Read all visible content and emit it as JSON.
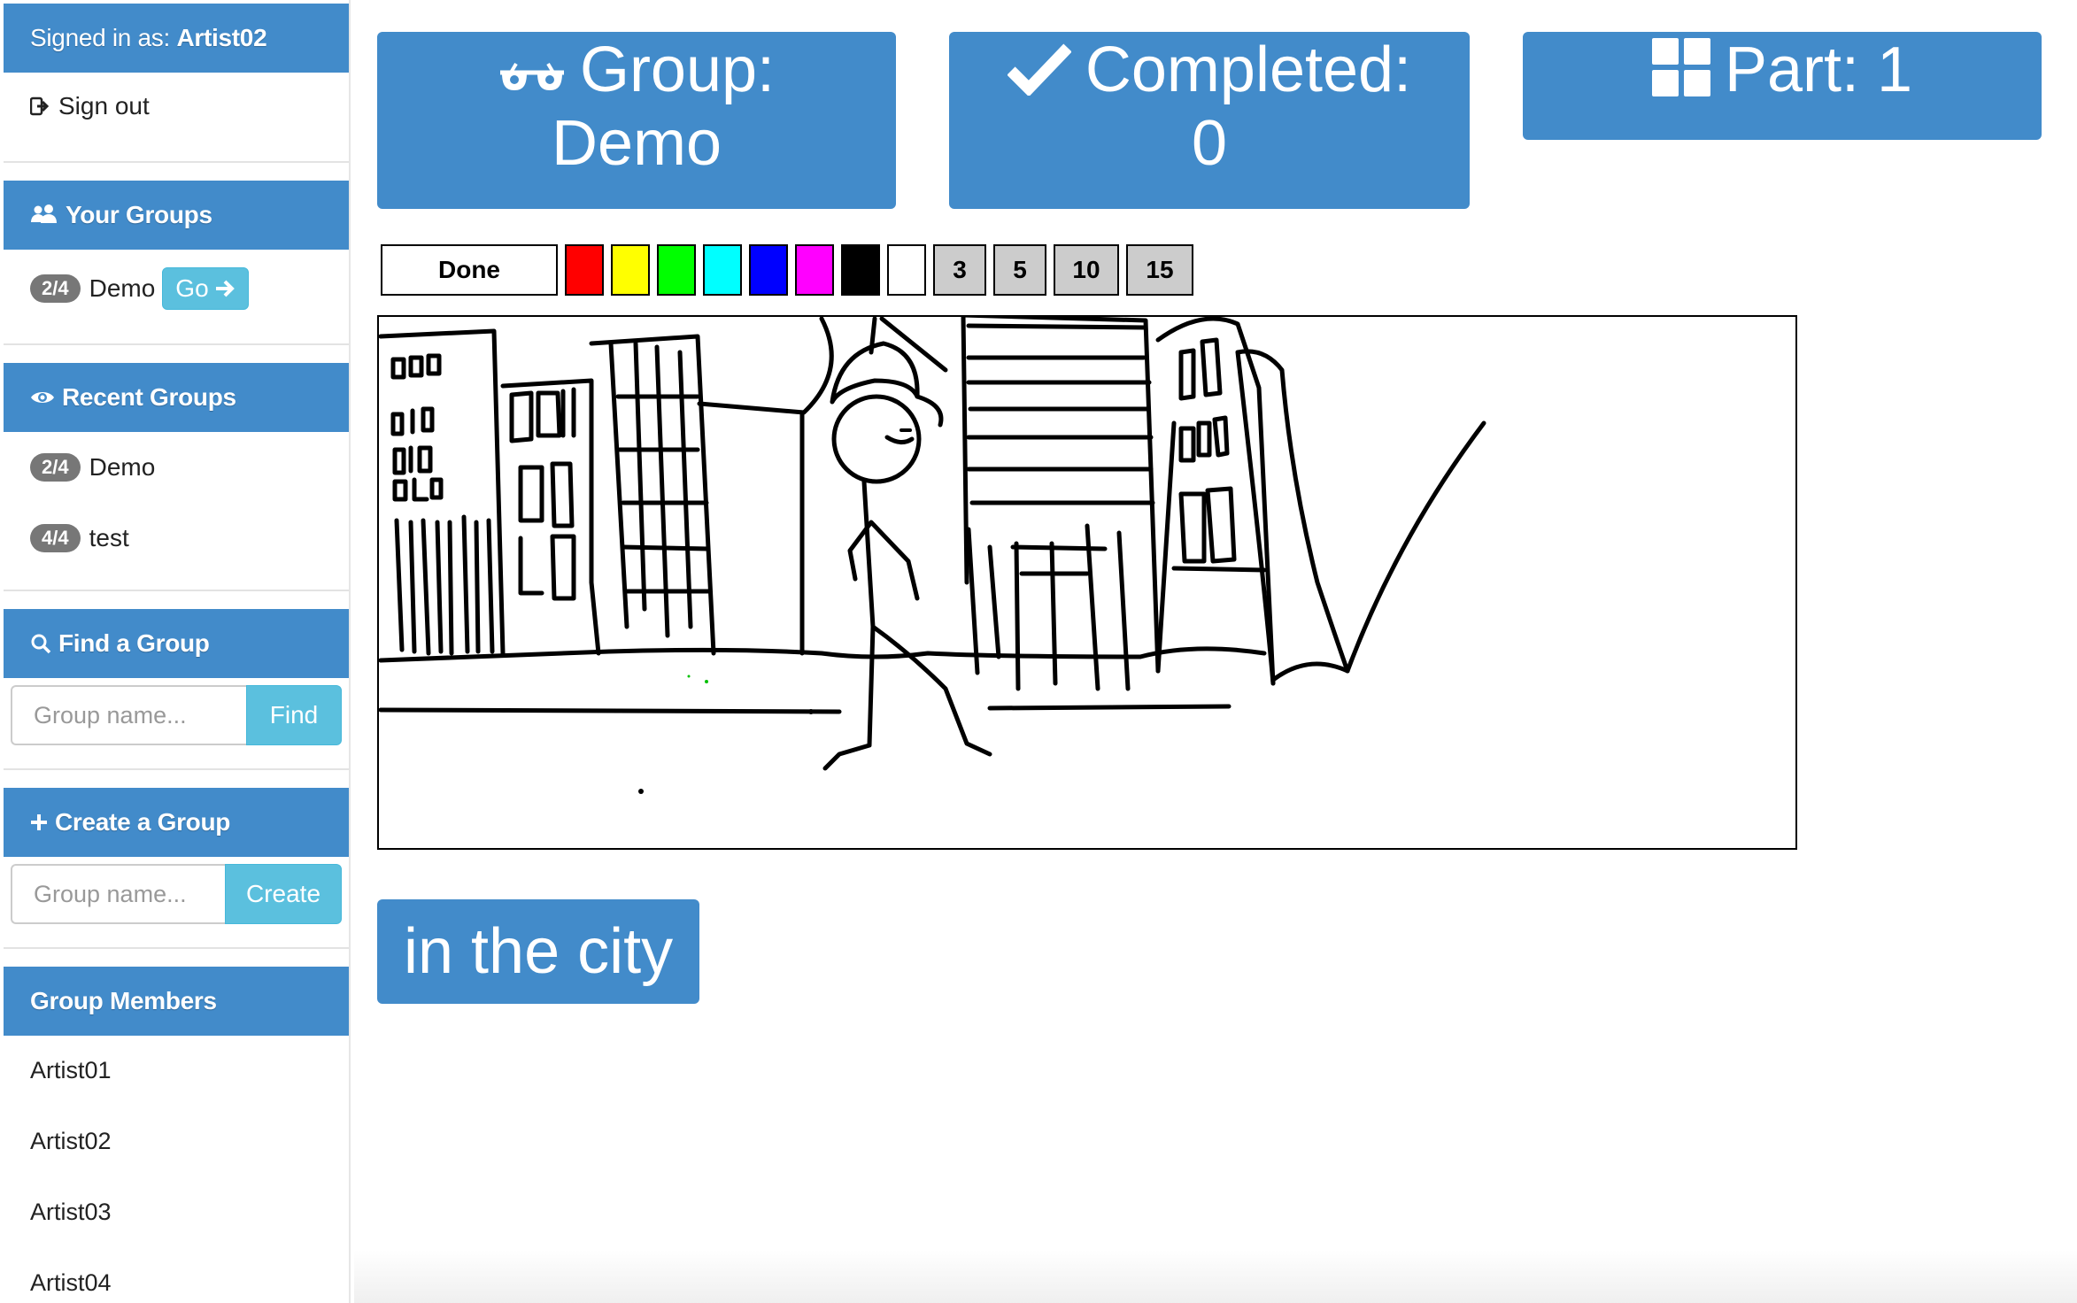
{
  "sidebar": {
    "signed_in_label": "Signed in as:",
    "username": "Artist02",
    "sign_out": "Sign out",
    "your_groups": {
      "title": "Your Groups",
      "items": [
        {
          "badge": "2/4",
          "name": "Demo",
          "go_label": "Go"
        }
      ]
    },
    "recent_groups": {
      "title": "Recent Groups",
      "items": [
        {
          "badge": "2/4",
          "name": "Demo"
        },
        {
          "badge": "4/4",
          "name": "test"
        }
      ]
    },
    "find_group": {
      "title": "Find a Group",
      "placeholder": "Group name...",
      "button": "Find"
    },
    "create_group": {
      "title": "Create a Group",
      "placeholder": "Group name...",
      "button": "Create"
    },
    "members": {
      "title": "Group Members",
      "items": [
        "Artist01",
        "Artist02",
        "Artist03",
        "Artist04"
      ]
    }
  },
  "stats": {
    "group_label": "Group:",
    "group_value": "Demo",
    "completed_label": "Completed:",
    "completed_value": "0",
    "part_label": "Part: 1"
  },
  "toolbar": {
    "done_label": "Done",
    "colors": [
      "#ff0000",
      "#ffff00",
      "#00ff00",
      "#00ffff",
      "#0000ff",
      "#ff00ff",
      "#000000",
      "#ffffff"
    ],
    "sizes": [
      "3",
      "5",
      "10",
      "15"
    ]
  },
  "prompt": "in the city",
  "theme": {
    "primary": "#428bca",
    "info": "#5bc0de",
    "badge": "#777777"
  },
  "icons": [
    "sign-out-icon",
    "users-icon",
    "arrow-right-icon",
    "eye-icon",
    "search-icon",
    "plus-icon",
    "glasses-icon",
    "check-icon",
    "grid-icon"
  ]
}
